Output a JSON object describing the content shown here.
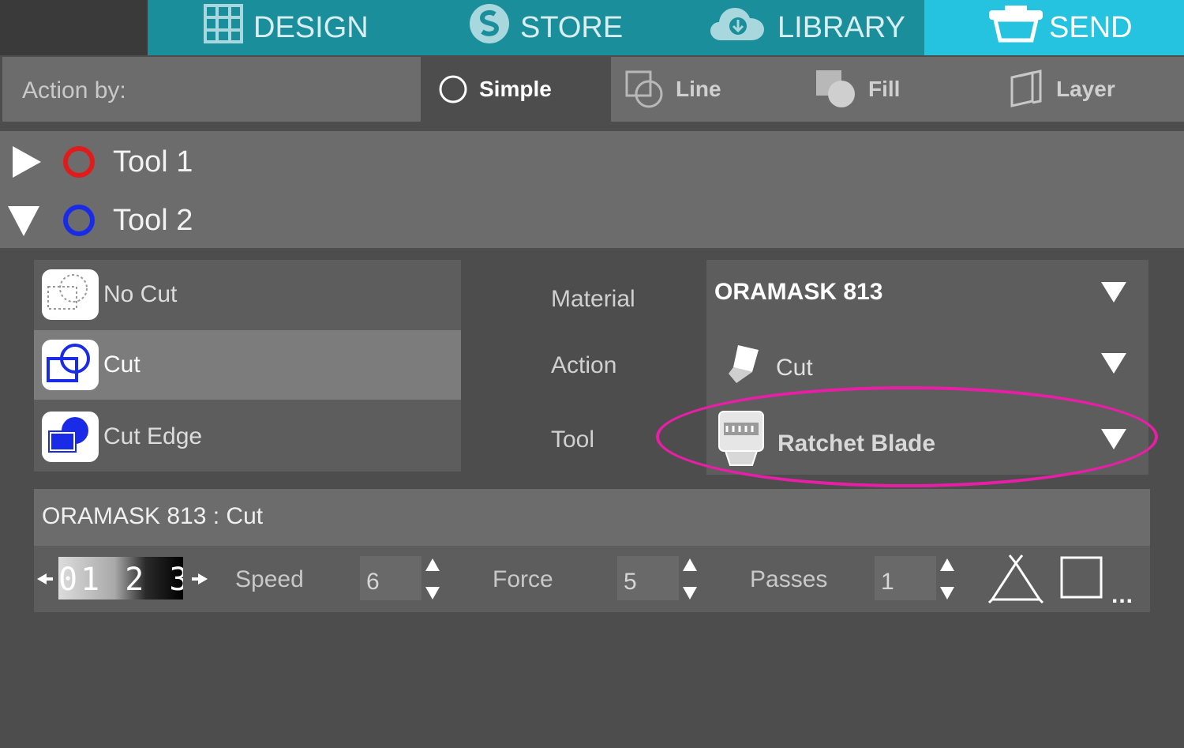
{
  "nav": {
    "design": "DESIGN",
    "store": "STORE",
    "library": "LIBRARY",
    "send": "SEND",
    "active": "SEND"
  },
  "action_by": {
    "label": "Action by:",
    "modes": [
      "Simple",
      "Line",
      "Fill",
      "Layer"
    ],
    "selected": "Simple"
  },
  "tools": [
    {
      "label": "Tool 1",
      "color": "#e11b1b",
      "expanded": false
    },
    {
      "label": "Tool 2",
      "color": "#1a2be8",
      "expanded": true
    }
  ],
  "cut_options": [
    {
      "label": "No Cut",
      "selected": false
    },
    {
      "label": "Cut",
      "selected": true
    },
    {
      "label": "Cut Edge",
      "selected": false
    }
  ],
  "fields": {
    "material_label": "Material",
    "material_value": "ORAMASK 813",
    "action_label": "Action",
    "action_value": "Cut",
    "tool_label": "Tool",
    "tool_value": "Ratchet Blade"
  },
  "summary": "ORAMASK 813 : Cut",
  "blade_ruler": "01 2 3",
  "params": {
    "speed_label": "Speed",
    "speed_value": "6",
    "force_label": "Force",
    "force_value": "5",
    "passes_label": "Passes",
    "passes_value": "1",
    "more": "..."
  },
  "colors": {
    "nav": "#1b8e9c",
    "nav_active": "#25c3e0",
    "highlight": "#e81fa6"
  }
}
